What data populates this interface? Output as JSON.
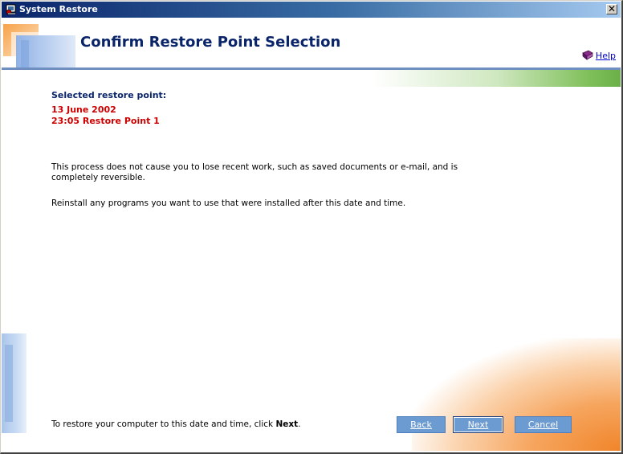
{
  "window": {
    "title": "System Restore"
  },
  "header": {
    "title": "Confirm Restore Point Selection",
    "help_label": "Help"
  },
  "selection": {
    "label": "Selected restore point:",
    "date": "13 June 2002",
    "point": "23:05 Restore Point 1"
  },
  "body": {
    "paragraph1": "This process does not cause you to lose recent work, such as saved documents or e-mail, and is completely reversible.",
    "paragraph2": "Reinstall any programs you want to use that were installed after this date and time."
  },
  "footer": {
    "instruction_prefix": "To restore your computer to this date and time, click ",
    "instruction_bold": "Next",
    "instruction_suffix": "."
  },
  "buttons": {
    "back": "Back",
    "next": "Next",
    "cancel": "Cancel"
  },
  "icons": {
    "app": "system-restore-icon",
    "close": "close-icon",
    "help": "help-book-icon",
    "logo": "system-restore-logo"
  },
  "colors": {
    "title_text": "#0a246a",
    "selected_value": "#cc0000",
    "button": "#6c9bd1",
    "green_band": "#6aaf48",
    "orange_accent": "#f0852a"
  }
}
